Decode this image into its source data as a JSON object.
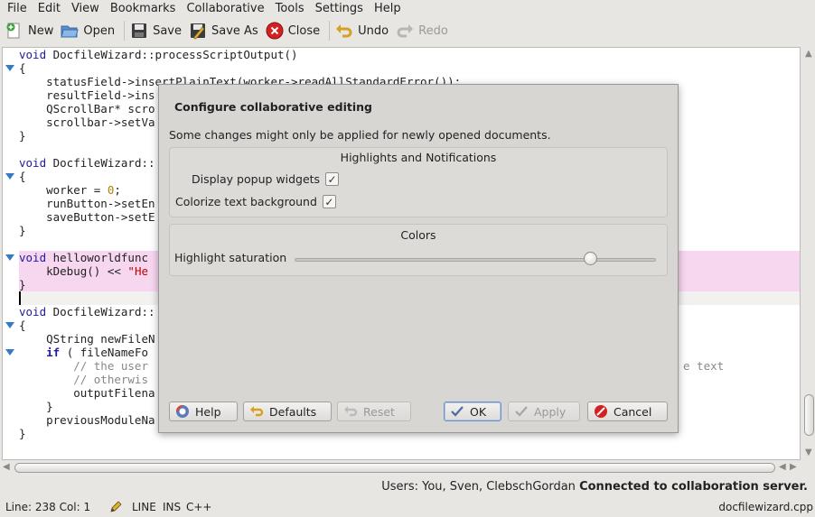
{
  "menu": [
    "File",
    "Edit",
    "View",
    "Bookmarks",
    "Collaborative",
    "Tools",
    "Settings",
    "Help"
  ],
  "toolbar": {
    "new": "New",
    "open": "Open",
    "save": "Save",
    "save_as": "Save As",
    "close": "Close",
    "undo": "Undo",
    "redo": "Redo"
  },
  "code": {
    "l1_ret": "void",
    "l1_rest": " DocfileWizard::processScriptOutput()",
    "l2": "{",
    "l3": "    statusField->insertPlainText(worker->readAllStandardError());",
    "l4": "    resultField->ins",
    "l5": "    QScrollBar* scro",
    "l6": "    scrollbar->setVa",
    "l7": "}",
    "l9_ret": "void",
    "l9_rest": " DocfileWizard::",
    "l10": "{",
    "l11a": "    worker = ",
    "l11n": "0",
    "l11b": ";",
    "l12": "    runButton->setEn",
    "l13": "    saveButton->setE",
    "l14": "}",
    "l16_ret": "void",
    "l16_rest": " helloworldfunc",
    "l17a": "    kDebug() << ",
    "l17s": "\"He",
    "l18": "}",
    "l20_ret": "void",
    "l20_rest": " DocfileWizard::",
    "l21": "{",
    "l22": "    QString newFileN",
    "l23a": "    ",
    "l23k": "if",
    "l23b": " ( fileNameFo",
    "l24": "        // the user",
    "l24r": "e text",
    "l25": "        // otherwis",
    "l26": "        outputFilena",
    "l27": "    }",
    "l28": "    previousModuleNa",
    "l29": "}"
  },
  "collab_status": {
    "users": "Users: You, Sven, ClebschGordan",
    "connection": "Connected to collaboration server."
  },
  "statusbar": {
    "position": "Line: 238 Col: 1",
    "mode": "LINE",
    "ins": "INS",
    "lang": "C++",
    "file": "docfilewizard.cpp"
  },
  "dialog": {
    "title": "Configure collaborative editing",
    "note": "Some changes might only be applied for newly opened documents.",
    "group1_title": "Highlights and Notifications",
    "popup_label": "Display popup widgets",
    "popup_checked": true,
    "colorize_label": "Colorize text background",
    "colorize_checked": true,
    "group2_title": "Colors",
    "saturation_label": "Highlight saturation",
    "saturation_value": 0.82,
    "buttons": {
      "help": "Help",
      "defaults": "Defaults",
      "reset": "Reset",
      "ok": "OK",
      "apply": "Apply",
      "cancel": "Cancel"
    }
  },
  "check_glyph": "✓",
  "colors": {
    "keyword": "#1f1c9f",
    "highlight_bg": "#f7d6f0",
    "accent": "#3879c4"
  }
}
